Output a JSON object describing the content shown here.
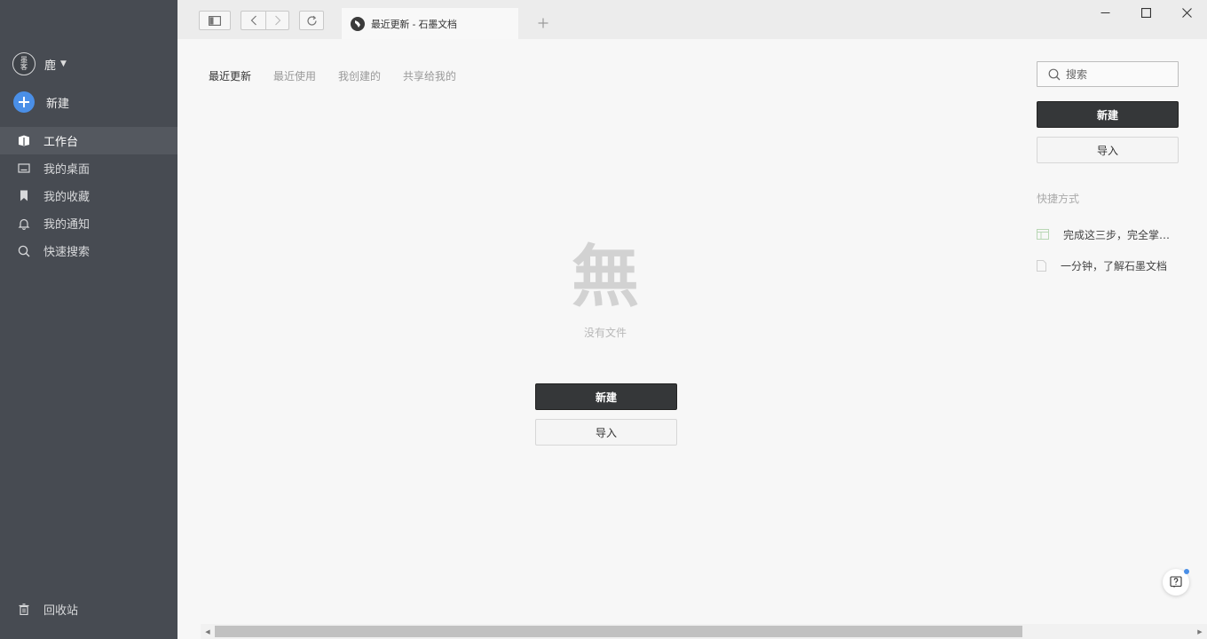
{
  "sidebar": {
    "user": {
      "avatar_top": "墨",
      "avatar_bottom": "客",
      "name": "鹿"
    },
    "new_label": "新建",
    "items": [
      {
        "label": "工作台",
        "icon": "workbench-icon",
        "active": true
      },
      {
        "label": "我的桌面",
        "icon": "desktop-icon",
        "active": false
      },
      {
        "label": "我的收藏",
        "icon": "bookmark-icon",
        "active": false
      },
      {
        "label": "我的通知",
        "icon": "bell-icon",
        "active": false
      },
      {
        "label": "快速搜索",
        "icon": "search-icon",
        "active": false
      }
    ],
    "trash_label": "回收站"
  },
  "topbar": {
    "tab_title": "最近更新 - 石墨文档"
  },
  "filters": [
    {
      "label": "最近更新",
      "active": true
    },
    {
      "label": "最近使用",
      "active": false
    },
    {
      "label": "我创建的",
      "active": false
    },
    {
      "label": "共享给我的",
      "active": false
    }
  ],
  "empty": {
    "glyph": "無",
    "text": "没有文件",
    "new_label": "新建",
    "import_label": "导入"
  },
  "right": {
    "search_placeholder": "搜索",
    "new_label": "新建",
    "import_label": "导入",
    "shortcut_title": "快捷方式",
    "shortcuts": [
      {
        "label": "完成这三步，完全掌握石墨文档",
        "icon": "sheet-icon"
      },
      {
        "label": "一分钟，了解石墨文档",
        "icon": "doc-icon"
      }
    ]
  },
  "colors": {
    "sidebar_bg": "#474b52",
    "accent_blue": "#4a8fe7",
    "dark_button": "#353739"
  }
}
